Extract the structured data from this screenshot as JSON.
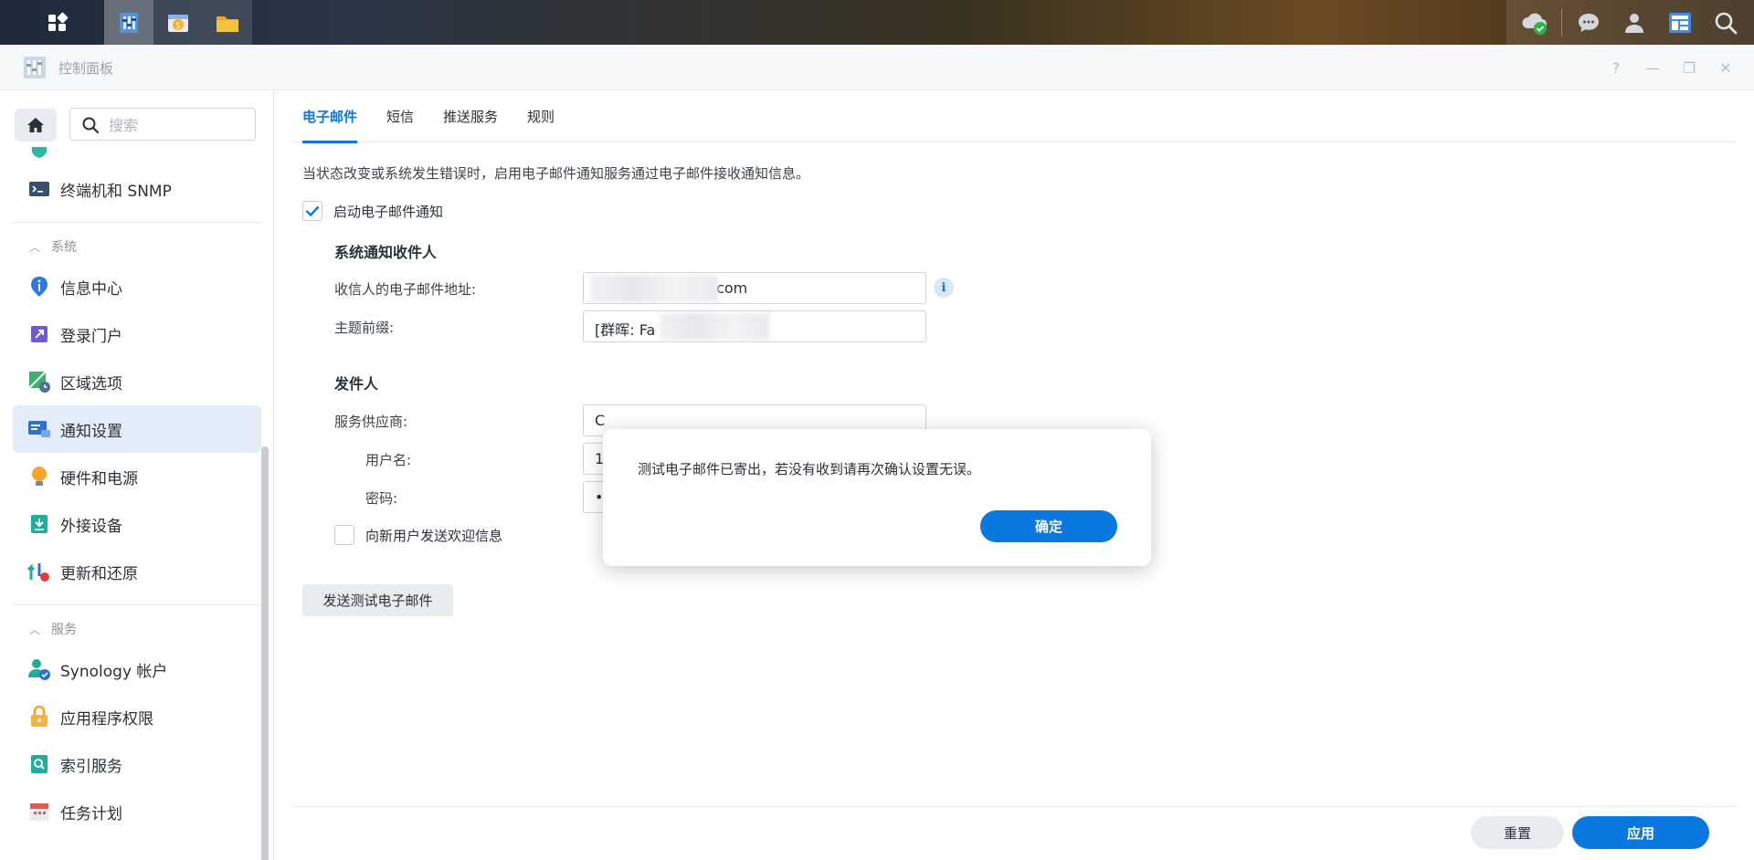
{
  "window": {
    "title": "控制面板",
    "controls": [
      "?",
      "—",
      "❐",
      "✕"
    ]
  },
  "taskbar": {
    "left_icons": [
      "apps-grid-icon",
      "control-panel-icon",
      "package-center-icon",
      "file-station-icon"
    ],
    "right_icons": [
      "cloud-sync-icon",
      "chat-icon",
      "user-icon",
      "widgets-icon",
      "search-icon"
    ]
  },
  "sidebar": {
    "search_placeholder": "搜索",
    "items_top": [
      {
        "label": "终端机和 SNMP",
        "icon": "terminal-icon"
      }
    ],
    "section_system": "系统",
    "items_system": [
      {
        "label": "信息中心",
        "icon": "info-icon"
      },
      {
        "label": "登录门户",
        "icon": "login-portal-icon"
      },
      {
        "label": "区域选项",
        "icon": "region-icon"
      },
      {
        "label": "通知设置",
        "icon": "notification-icon",
        "selected": true
      },
      {
        "label": "硬件和电源",
        "icon": "bulb-icon"
      },
      {
        "label": "外接设备",
        "icon": "external-device-icon"
      },
      {
        "label": "更新和还原",
        "icon": "update-icon"
      }
    ],
    "section_services": "服务",
    "items_services": [
      {
        "label": "Synology 帐户",
        "icon": "synology-account-icon"
      },
      {
        "label": "应用程序权限",
        "icon": "lock-icon"
      },
      {
        "label": "索引服务",
        "icon": "index-icon"
      },
      {
        "label": "任务计划",
        "icon": "calendar-icon"
      }
    ]
  },
  "tabs": [
    "电子邮件",
    "短信",
    "推送服务",
    "规则"
  ],
  "content": {
    "description": "当状态改变或系统发生错误时，启用电子邮件通知服务通过电子邮件接收通知信息。",
    "enable_email_label": "启动电子邮件通知",
    "recipients_heading": "系统通知收件人",
    "recipient_email_label": "收信人的电子邮件地址:",
    "recipient_email_value": ".com",
    "subject_prefix_label": "主题前缀:",
    "subject_prefix_value": "[群晖: Fa",
    "sender_heading": "发件人",
    "provider_label": "服务供应商:",
    "provider_value": "C",
    "username_label": "用户名:",
    "username_value": "1",
    "password_label": "密码:",
    "password_value": "•",
    "welcome_label": "向新用户发送欢迎信息",
    "send_test_label": "发送测试电子邮件"
  },
  "footer": {
    "reset_label": "重置",
    "apply_label": "应用"
  },
  "dialog": {
    "message": "测试电子邮件已寄出，若没有收到请再次确认设置无误。",
    "ok_label": "确定"
  },
  "colors": {
    "accent": "#0b78e0",
    "selected_bg": "#e3edf9"
  }
}
